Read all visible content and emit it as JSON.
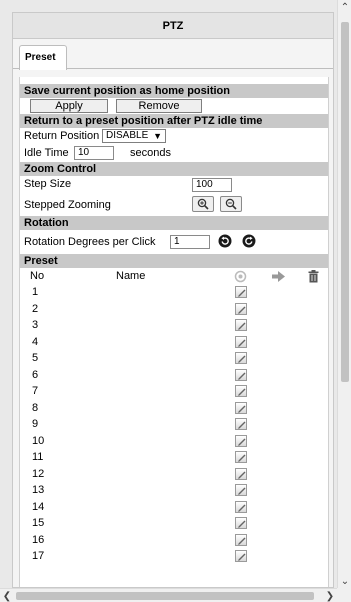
{
  "panel": {
    "title": "PTZ"
  },
  "tabs": [
    {
      "label": "Preset"
    }
  ],
  "home": {
    "section": "Save current position as home position",
    "apply_label": "Apply",
    "remove_label": "Remove"
  },
  "idle": {
    "section": "Return to a preset position after PTZ idle time",
    "return_label": "Return Position",
    "return_value": "DISABLE",
    "idle_label": "Idle Time",
    "idle_value": "10",
    "idle_unit": "seconds"
  },
  "zoom": {
    "section": "Zoom Control",
    "step_label": "Step Size",
    "step_value": "100",
    "stepped_label": "Stepped Zooming"
  },
  "rotation": {
    "section": "Rotation",
    "deg_label": "Rotation Degrees per Click",
    "deg_value": "1"
  },
  "preset": {
    "section": "Preset",
    "col_no": "No",
    "col_name": "Name",
    "rows": [
      {
        "no": "1"
      },
      {
        "no": "2"
      },
      {
        "no": "3"
      },
      {
        "no": "4"
      },
      {
        "no": "5"
      },
      {
        "no": "6"
      },
      {
        "no": "7"
      },
      {
        "no": "8"
      },
      {
        "no": "9"
      },
      {
        "no": "10"
      },
      {
        "no": "11"
      },
      {
        "no": "12"
      },
      {
        "no": "13"
      },
      {
        "no": "14"
      },
      {
        "no": "15"
      },
      {
        "no": "16"
      },
      {
        "no": "17"
      }
    ]
  },
  "icons": {
    "header_set": "target-icon",
    "header_goto": "arrow-right-icon",
    "header_delete": "trash-icon",
    "row_set": "pencil-icon",
    "zoom_in": "zoom-in-icon",
    "zoom_out": "zoom-out-icon",
    "rotate_left": "rotate-left-icon",
    "rotate_right": "rotate-right-icon"
  }
}
